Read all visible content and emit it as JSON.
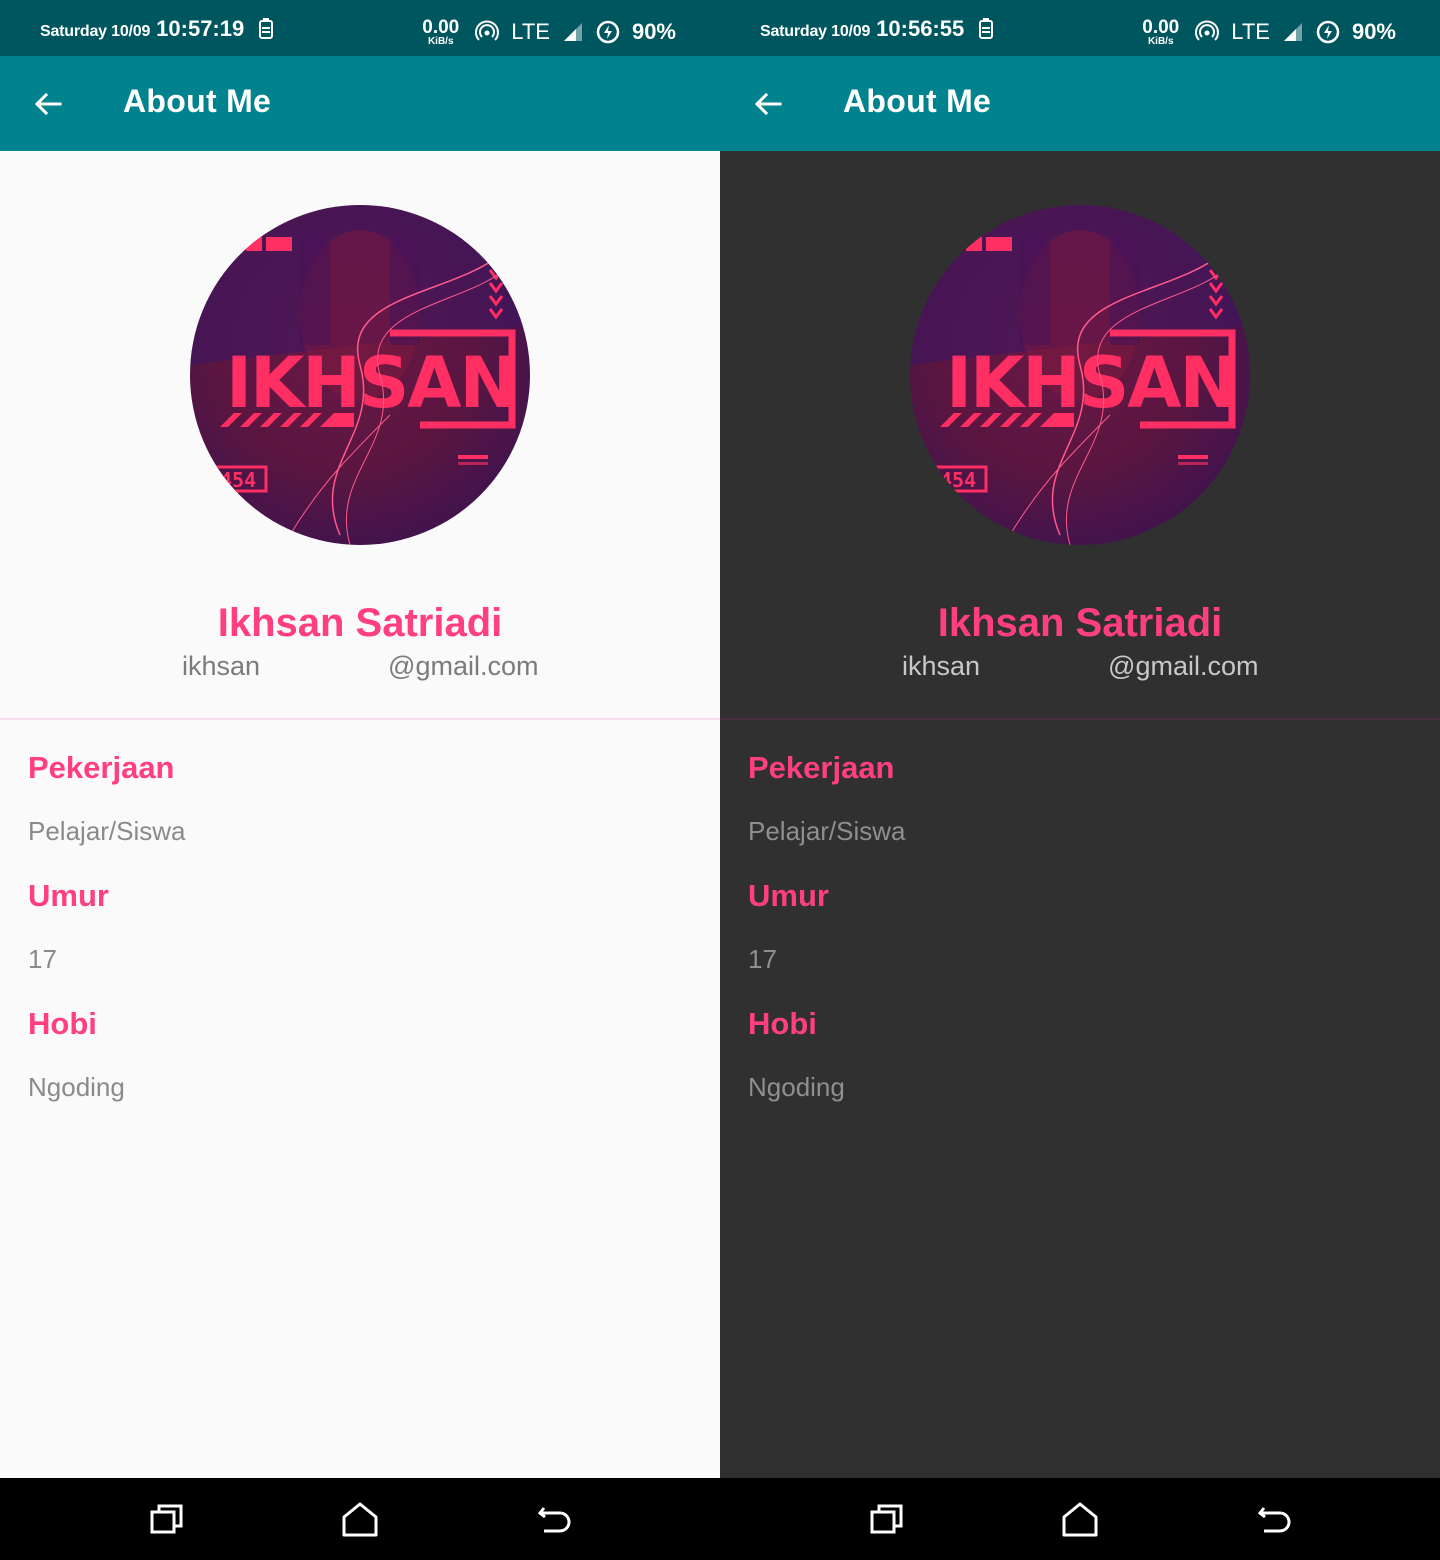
{
  "panels": [
    {
      "theme": "light",
      "status_bar": {
        "day_date": "Saturday 10/09",
        "time": "10:57:19",
        "speed_value": "0.00",
        "speed_unit": "KiB/s",
        "network": "LTE",
        "battery": "90%",
        "icons": [
          "battery-saver-icon",
          "hotspot-icon",
          "signal-icon",
          "charging-icon"
        ]
      },
      "app_bar": {
        "title": "About Me",
        "back_icon": "arrow-back-icon"
      },
      "profile": {
        "name": "Ikhsan Satriadi",
        "email_prefix": "ikhsan",
        "email_suffix": "@gmail.com",
        "avatar_logo_text": "IKHSAN"
      },
      "details": [
        {
          "label": "Pekerjaan",
          "value": "Pelajar/Siswa"
        },
        {
          "label": "Umur",
          "value": "17"
        },
        {
          "label": "Hobi",
          "value": "Ngoding"
        }
      ]
    },
    {
      "theme": "dark",
      "status_bar": {
        "day_date": "Saturday 10/09",
        "time": "10:56:55",
        "speed_value": "0.00",
        "speed_unit": "KiB/s",
        "network": "LTE",
        "battery": "90%",
        "icons": [
          "battery-saver-icon",
          "hotspot-icon",
          "signal-icon",
          "charging-icon"
        ]
      },
      "app_bar": {
        "title": "About Me",
        "back_icon": "arrow-back-icon"
      },
      "profile": {
        "name": "Ikhsan Satriadi",
        "email_prefix": "ikhsan",
        "email_suffix": "@gmail.com",
        "avatar_logo_text": "IKHSAN"
      },
      "details": [
        {
          "label": "Pekerjaan",
          "value": "Pelajar/Siswa"
        },
        {
          "label": "Umur",
          "value": "17"
        },
        {
          "label": "Hobi",
          "value": "Ngoding"
        }
      ]
    }
  ],
  "navigation_bar": {
    "buttons": [
      "recents-icon",
      "home-icon",
      "back-icon"
    ]
  },
  "colors": {
    "status_bar": "#00565f",
    "app_bar": "#00838f",
    "accent": "#ff3f7f",
    "light_background": "#fafafa",
    "dark_background": "#303030"
  }
}
